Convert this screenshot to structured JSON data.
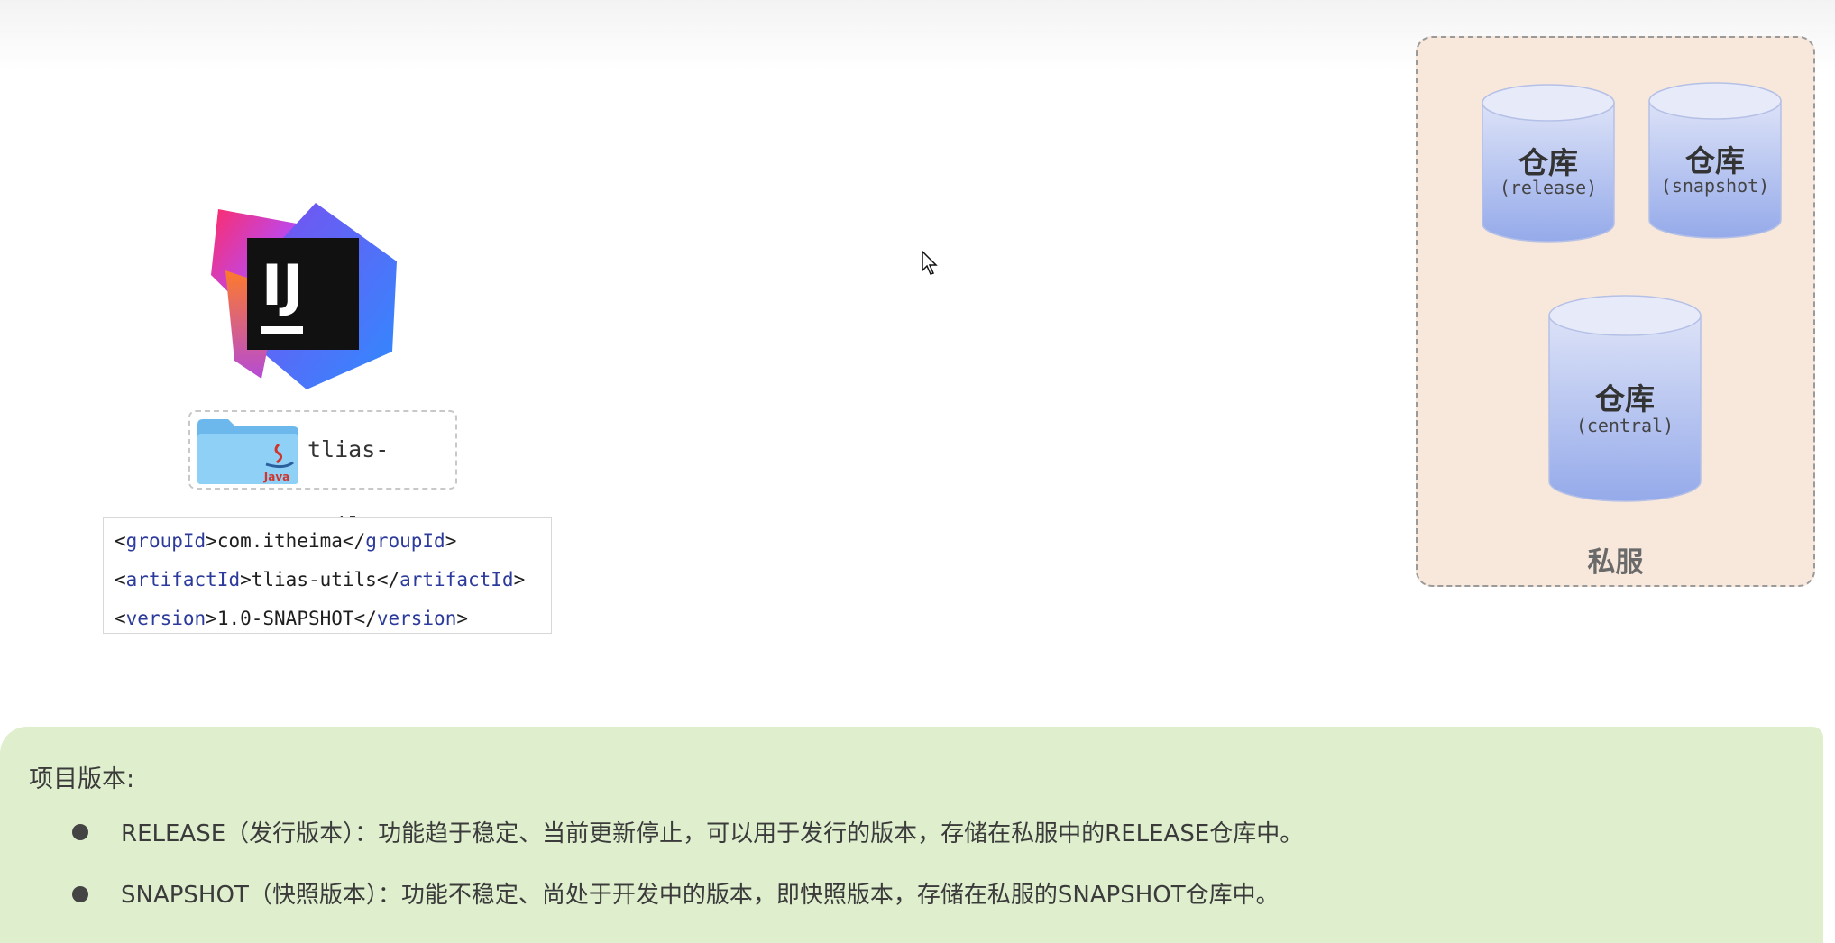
{
  "project": {
    "folder_name": "tlias-utils",
    "folder_badge": "Java"
  },
  "coordinates": {
    "lines": [
      {
        "open": "groupId",
        "value": "com.itheima",
        "close": "groupId"
      },
      {
        "open": "artifactId",
        "value": "tlias-utils",
        "close": "artifactId"
      },
      {
        "open": "version",
        "value": "1.0-SNAPSHOT",
        "close": "version"
      }
    ]
  },
  "private_server": {
    "label": "私服",
    "repos": [
      {
        "title": "仓库",
        "sub": "(release)"
      },
      {
        "title": "仓库",
        "sub": "(snapshot)"
      },
      {
        "title": "仓库",
        "sub": "(central)"
      }
    ]
  },
  "note": {
    "title": "项目版本:",
    "items": [
      "RELEASE（发行版本）：功能趋于稳定、当前更新停止，可以用于发行的版本，存储在私服中的RELEASE仓库中。",
      "SNAPSHOT（快照版本）：功能不稳定、尚处于开发中的版本，即快照版本，存储在私服的SNAPSHOT仓库中。"
    ]
  },
  "colors": {
    "panel_bg": "#f8e8dc",
    "note_bg": "#dfefcd",
    "cylinder_top": "#dce2f7",
    "cylinder_bottom": "#95aaea",
    "xml_tag": "#2b3a9b"
  },
  "icons": [
    "intellij-idea-logo-icon",
    "java-folder-icon",
    "mouse-cursor-icon"
  ]
}
